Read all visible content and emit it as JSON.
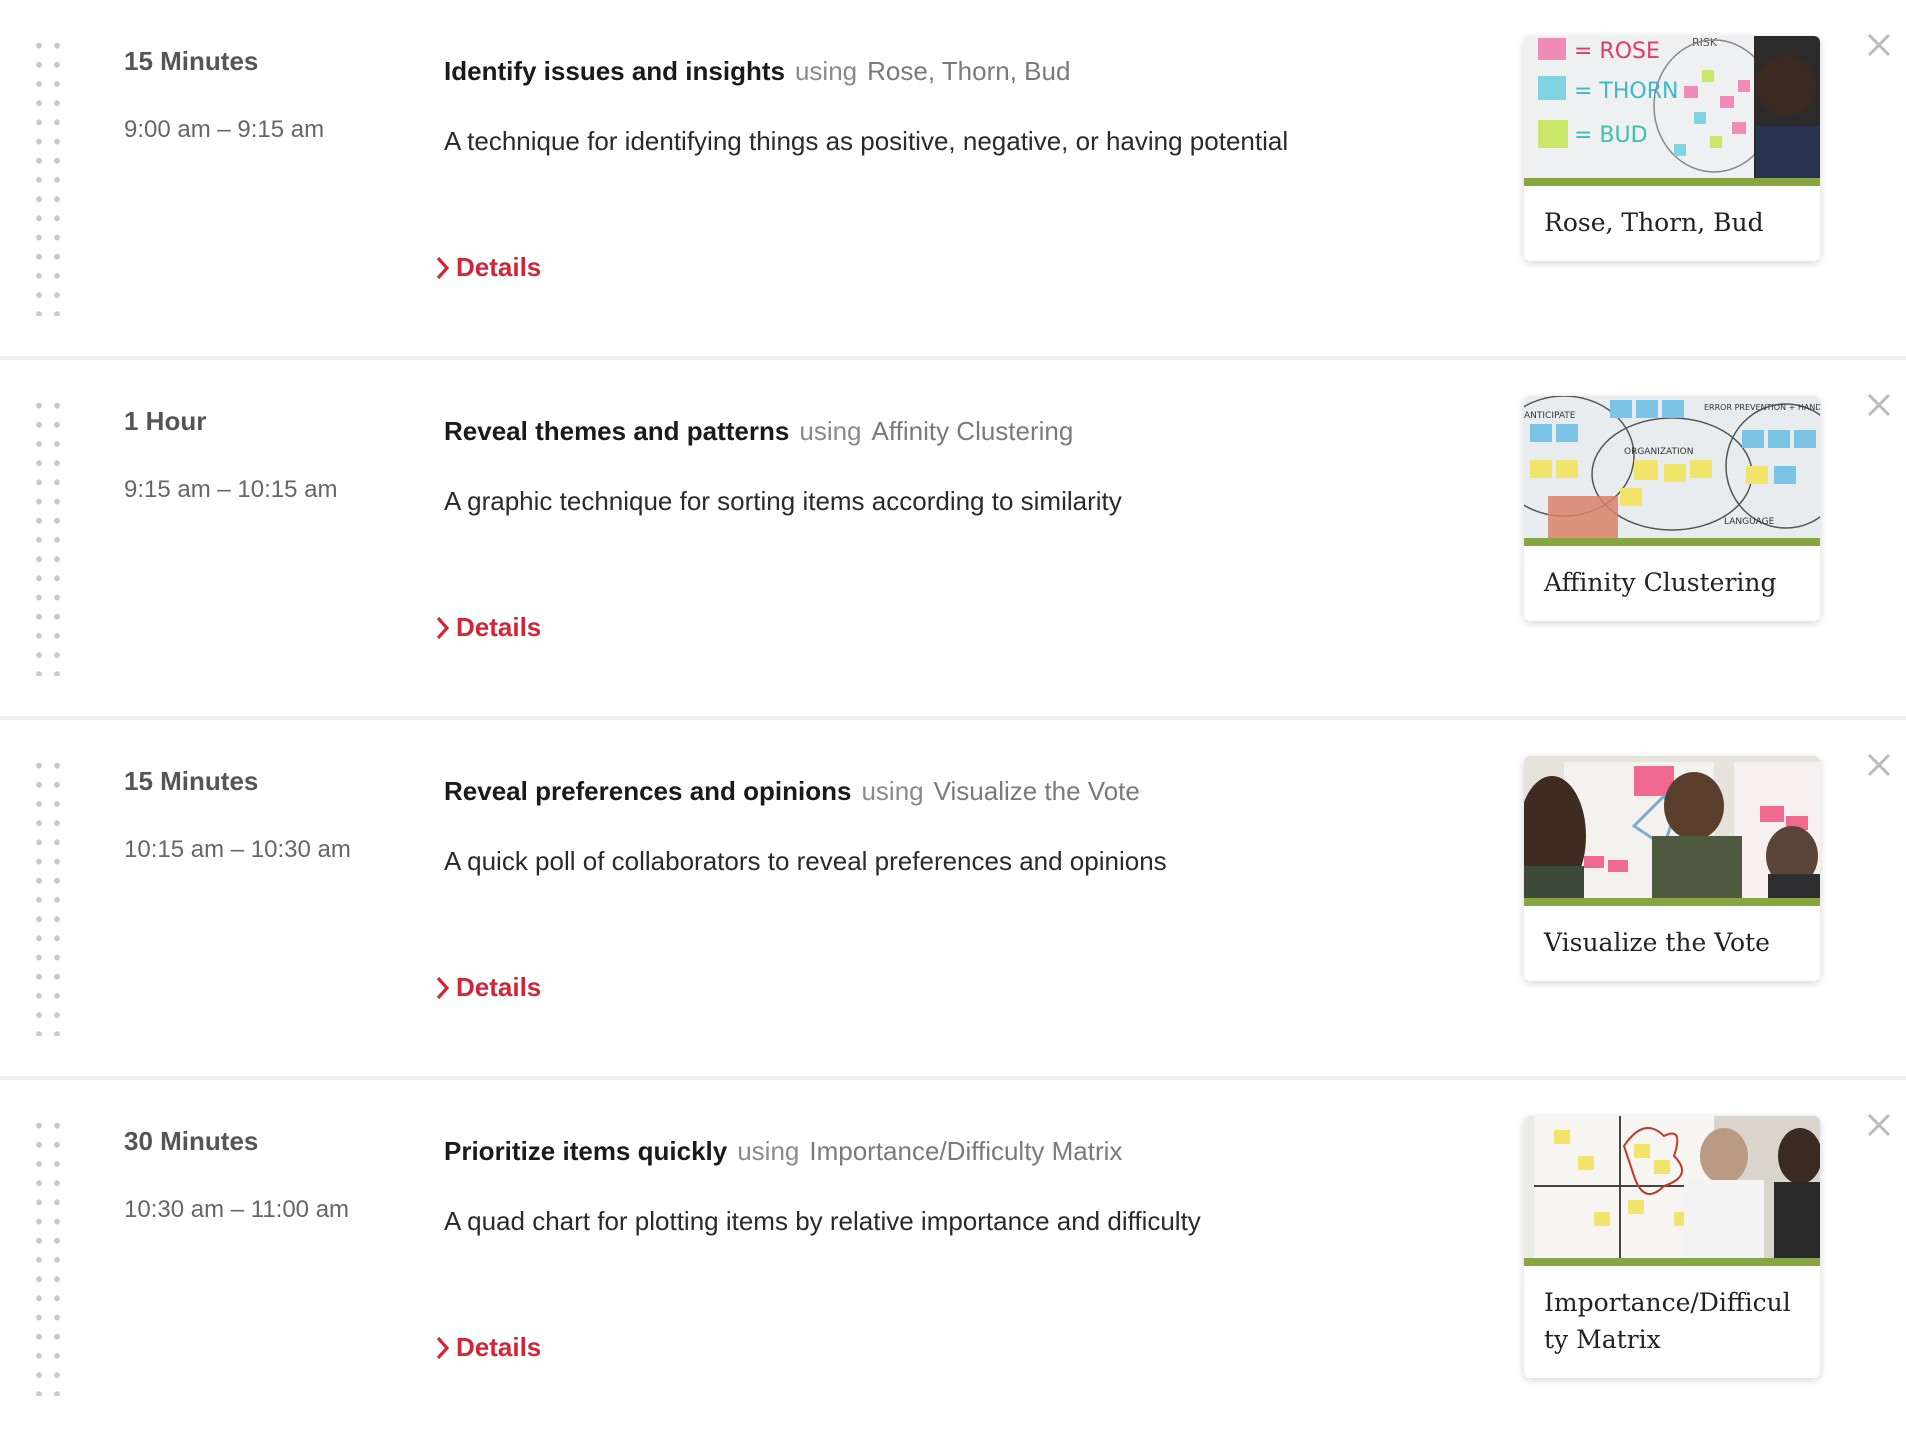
{
  "agenda": {
    "items": [
      {
        "duration": "15 Minutes",
        "time": "9:00 am – 9:15 am",
        "goal": "Identify issues and insights",
        "using": "using",
        "method": "Rose, Thorn, Bud",
        "description": "A technique for identifying things as positive, negative, or having potential",
        "details_label": "Details",
        "card_title": "Rose, Thorn, Bud",
        "image_labels": [
          "= ROSE",
          "= THORN",
          "= BUD",
          "RISK"
        ]
      },
      {
        "duration": "1 Hour",
        "time": "9:15 am – 10:15 am",
        "goal": "Reveal themes and patterns",
        "using": "using",
        "method": "Affinity Clustering",
        "description": "A graphic technique for sorting items according to similarity",
        "details_label": "Details",
        "card_title": "Affinity Clustering",
        "image_labels": [
          "ANTICIPATE",
          "ERROR PREVENTION + HANDLING",
          "ORGANIZATION",
          "LANGUAGE"
        ]
      },
      {
        "duration": "15 Minutes",
        "time": "10:15 am – 10:30 am",
        "goal": "Reveal preferences and opinions",
        "using": "using",
        "method": "Visualize the Vote",
        "description": "A quick poll of collaborators to reveal preferences and opinions",
        "details_label": "Details",
        "card_title": "Visualize the Vote"
      },
      {
        "duration": "30 Minutes",
        "time": "10:30 am – 11:00 am",
        "goal": "Prioritize items quickly",
        "using": "using",
        "method": "Importance/Difficulty Matrix",
        "description": "A quad chart for plotting items by relative importance and difficulty",
        "details_label": "Details",
        "card_title": "Importance/Difficulty Matrix"
      }
    ]
  },
  "colors": {
    "accent_red": "#d22638",
    "card_stripe_green": "#86a641",
    "divider": "#eeeeee"
  },
  "icons": {
    "drag": "drag-handle-dots-icon",
    "details": "chevron-right-icon",
    "close": "close-x-icon"
  }
}
